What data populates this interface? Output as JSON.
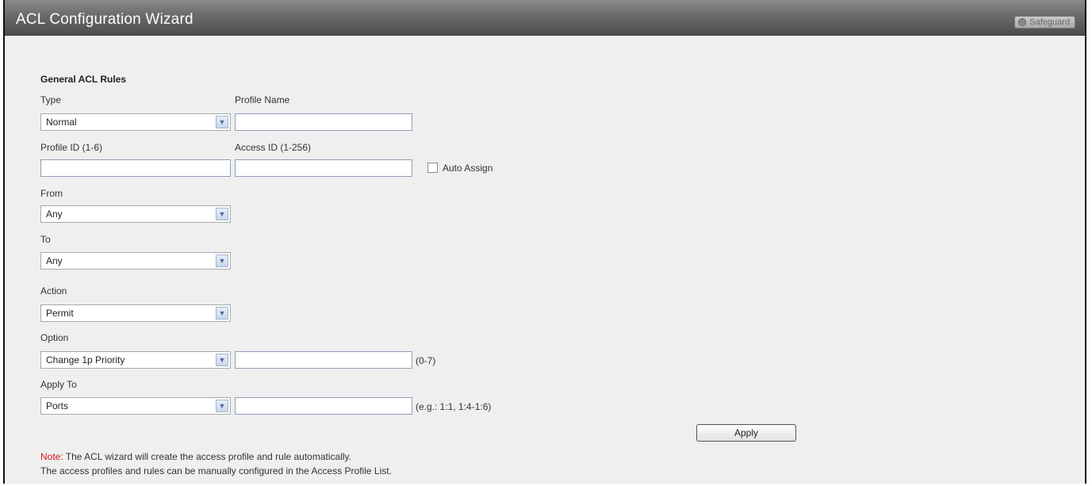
{
  "window": {
    "title": "ACL Configuration Wizard",
    "safeguard_label": "Safeguard"
  },
  "form": {
    "section_title": "General ACL Rules",
    "type": {
      "label": "Type",
      "value": "Normal"
    },
    "profile_name": {
      "label": "Profile Name",
      "value": ""
    },
    "profile_id": {
      "label": "Profile ID (1-6)",
      "value": ""
    },
    "access_id": {
      "label": "Access ID (1-256)",
      "value": ""
    },
    "auto_assign": {
      "label": "Auto Assign",
      "checked": false
    },
    "from": {
      "label": "From",
      "value": "Any"
    },
    "to": {
      "label": "To",
      "value": "Any"
    },
    "action": {
      "label": "Action",
      "value": "Permit"
    },
    "option": {
      "label": "Option",
      "value": "Change 1p Priority",
      "input_value": "",
      "hint": "(0-7)"
    },
    "apply_to": {
      "label": "Apply To",
      "value": "Ports",
      "input_value": "",
      "hint": "(e.g.: 1:1, 1:4-1:6)"
    },
    "apply_button": "Apply"
  },
  "note": {
    "label": "Note:",
    "line1": " The ACL wizard will create the access profile and rule automatically.",
    "line2": "The access profiles and rules can be manually configured in the Access Profile List."
  },
  "colors": {
    "note_label": "#d4161a",
    "titlebar": "#6a6a6a",
    "panel_bg": "#efefef"
  }
}
